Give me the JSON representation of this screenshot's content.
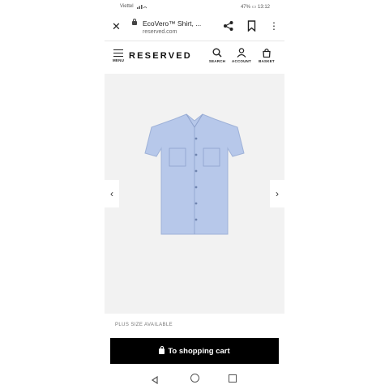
{
  "status_bar": {
    "carrier": "Viettel",
    "battery": "47%",
    "time": "13:12"
  },
  "browser": {
    "page_title": "EcoVero™ Shirt, ...",
    "url": "reserved.com",
    "icons": [
      "close-icon",
      "lock-icon",
      "share-icon",
      "bookmark-icon",
      "more-icon"
    ]
  },
  "site_header": {
    "menu_label": "MENU",
    "logo": "RESERVED",
    "search_label": "SEARCH",
    "account_label": "ACCOUNT",
    "basket_label": "BASKET"
  },
  "product": {
    "shirt_color": "#b7c8ea",
    "plus_size_note": "PLUS SIZE AVAILABLE",
    "cart_button_label": "To shopping cart"
  },
  "system_nav": {
    "icons": [
      "back-icon",
      "home-icon",
      "recent-apps-icon"
    ]
  }
}
